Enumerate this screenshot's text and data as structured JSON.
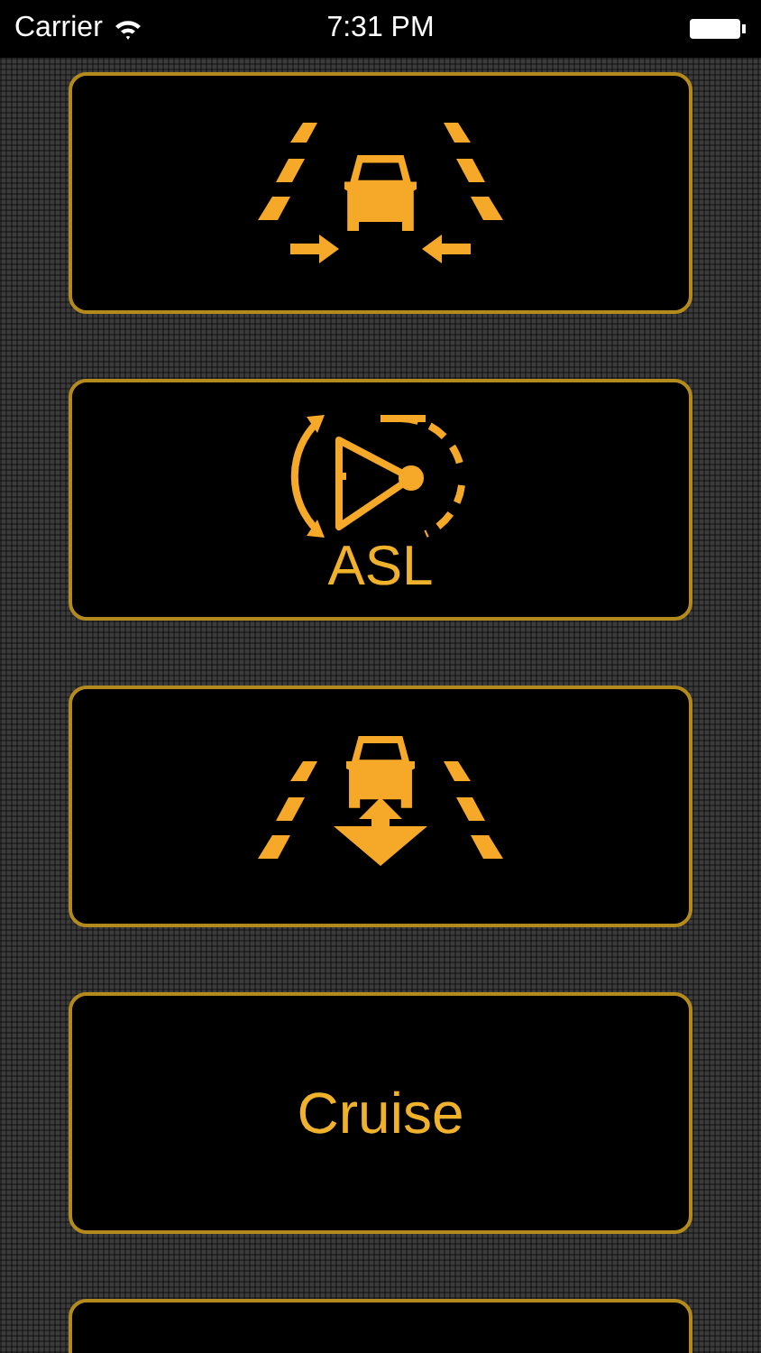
{
  "status_bar": {
    "carrier": "Carrier",
    "time": "7:31 PM"
  },
  "tiles": [
    {
      "kind": "lane-assist"
    },
    {
      "kind": "speed-limiter",
      "label": "ASL"
    },
    {
      "kind": "distance-control"
    },
    {
      "kind": "text",
      "label": "Cruise"
    },
    {
      "kind": "empty"
    }
  ]
}
